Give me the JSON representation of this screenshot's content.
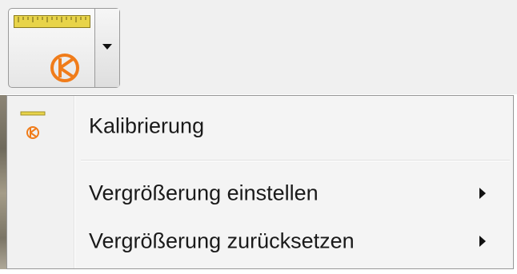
{
  "toolbar": {
    "calibration_split_button": {
      "main_icons": [
        "ruler-icon",
        "calibration-icon"
      ],
      "dropdown_icon": "dropdown-arrow-icon"
    }
  },
  "menu": {
    "items": [
      {
        "label": "Kalibrierung",
        "icon": "calibration-icon",
        "has_submenu": false
      },
      {
        "label": "Vergrößerung einstellen",
        "icon": "",
        "has_submenu": true
      },
      {
        "label": "Vergrößerung zurücksetzen",
        "icon": "",
        "has_submenu": true
      }
    ]
  },
  "colors": {
    "ruler_yellow": "#e8d44a",
    "calibration_orange": "#f07c1a",
    "menu_background": "#f4f4f4",
    "toolbar_background": "#f0f0f0"
  }
}
